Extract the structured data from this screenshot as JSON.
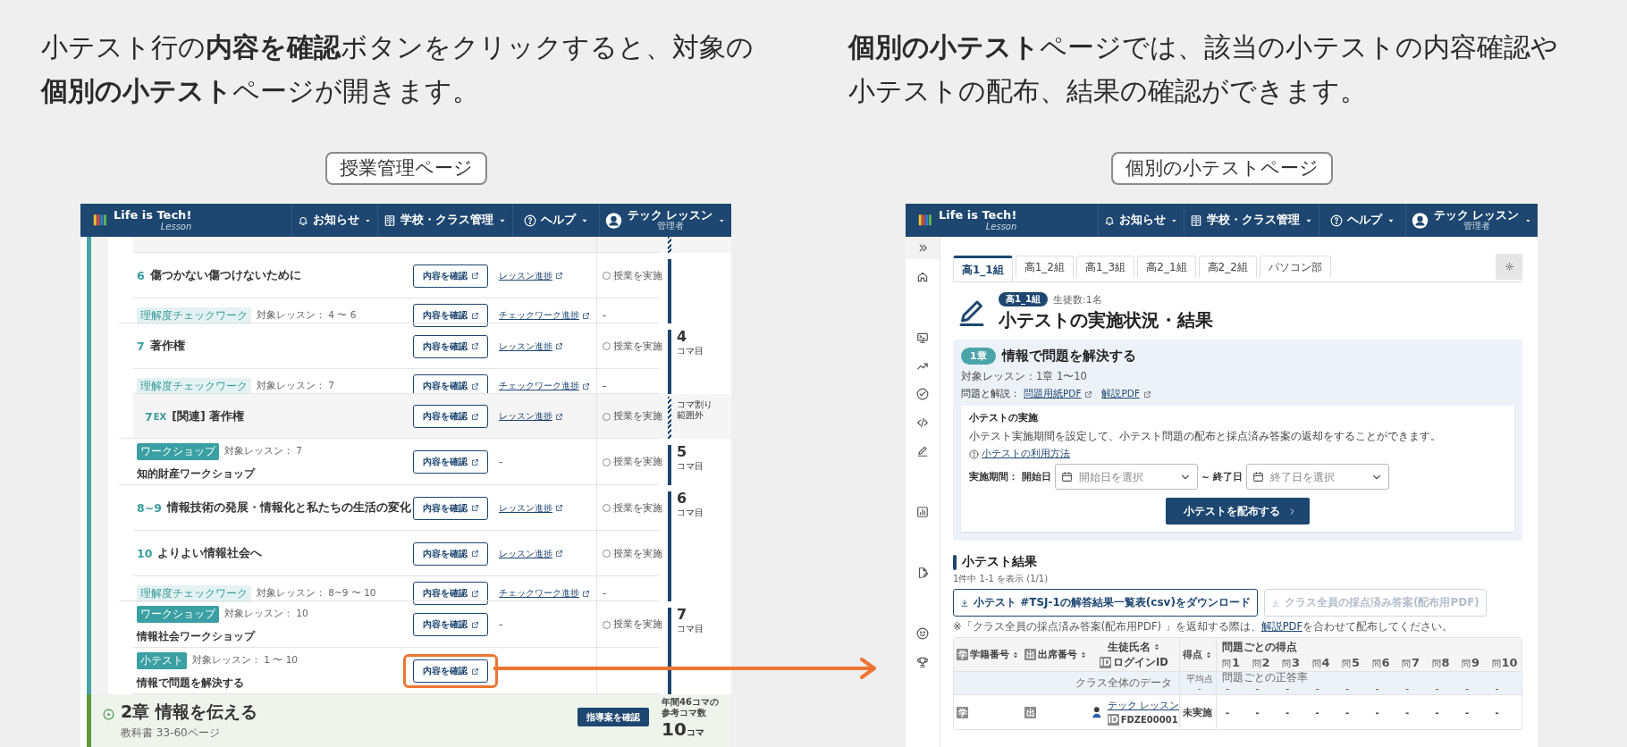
{
  "captions": [
    {
      "text": "小テスト行の**内容を確認**ボタンをクリックすると、対象の**個別の小テスト**ページが開きます。"
    },
    {
      "text": "**個別の小テスト**ページでは、該当の小テストの内容確認や小テストの配布、結果の確認ができます。"
    }
  ],
  "lesson_page": {
    "label": "授業管理ページ",
    "header": {
      "logo": "Life is Tech!",
      "logo_sub": "Lesson",
      "menus": [
        {
          "label": "お知らせ"
        },
        {
          "label": "学校・クラス管理"
        },
        {
          "label": "ヘルプ"
        }
      ],
      "user": {
        "name": "テック レッスン",
        "role": "管理者"
      }
    },
    "rows": [
      {
        "kind": "cut"
      },
      {
        "kind": "lesson",
        "number": "6",
        "title": "傷つかない傷つけないために",
        "button": "内容を確認",
        "highlighted": false,
        "link": "レッスン進捗",
        "status": "授業を実施",
        "checked": false
      },
      {
        "kind": "check",
        "tag": "理解度チェックワーク",
        "target": "対象レッスン： 4 〜 6",
        "button": "内容を確認",
        "highlighted": false,
        "link": "チェックワーク進捗",
        "status": "-"
      },
      {
        "kind": "lesson",
        "number": "7",
        "title": "著作権",
        "button": "内容を確認",
        "highlighted": false,
        "link": "レッスン進捗",
        "status": "授業を実施",
        "checked": false,
        "koma": "4",
        "koma_unit": "コマ目"
      },
      {
        "kind": "check",
        "tag": "理解度チェックワーク",
        "target": "対象レッスン： 7",
        "button": "内容を確認",
        "highlighted": false,
        "link": "チェックワーク進捗",
        "status": "-"
      },
      {
        "kind": "extra",
        "number": "7",
        "suffix": "EX",
        "title": "[関連] 著作権",
        "button": "内容を確認",
        "highlighted": false,
        "link": "レッスン進捗",
        "status": "授業を実施",
        "checked": false,
        "koma_note": "コマ割り範囲外"
      },
      {
        "kind": "workshop",
        "tag": "ワークショップ",
        "target": "対象レッスン： 7",
        "title": "知的財産ワークショップ",
        "button": "内容を確認",
        "highlighted": false,
        "link": "-",
        "status": "授業を実施",
        "checked": false,
        "koma": "5",
        "koma_unit": "コマ目"
      },
      {
        "kind": "lesson",
        "number": "8~9",
        "title": "情報技術の発展・情報化と私たちの生活の変化",
        "button": "内容を確認",
        "highlighted": false,
        "link": "レッスン進捗",
        "status": "授業を実施",
        "checked": false,
        "koma": "6",
        "koma_unit": "コマ目"
      },
      {
        "kind": "lesson",
        "number": "10",
        "title": "よりよい情報社会へ",
        "button": "内容を確認",
        "highlighted": false,
        "link": "レッスン進捗",
        "status": "授業を実施",
        "checked": false
      },
      {
        "kind": "check",
        "tag": "理解度チェックワーク",
        "target": "対象レッスン： 8~9 〜 10",
        "button": "内容を確認",
        "highlighted": false,
        "link": "チェックワーク進捗",
        "status": "-"
      },
      {
        "kind": "workshop",
        "tag": "ワークショップ",
        "target": "対象レッスン： 10",
        "title": "情報社会ワークショップ",
        "button": "内容を確認",
        "highlighted": false,
        "link": "-",
        "status": "授業を実施",
        "checked": false,
        "koma": "7",
        "koma_unit": "コマ目"
      },
      {
        "kind": "quiz",
        "tag": "小テスト",
        "target": "対象レッスン： 1 〜 10",
        "title": "情報で問題を解決する",
        "button": "内容を確認",
        "highlighted": true
      }
    ],
    "chapter": {
      "title": "2章 情報を伝える",
      "pages": "教科書 33-60ページ",
      "button": "指導案を確認",
      "koma_label": "年間46コマの参考コマ数",
      "koma": "10",
      "koma_unit": "コマ"
    }
  },
  "quiz_page": {
    "label": "個別の小テストページ",
    "header": {
      "logo": "Life is Tech!",
      "logo_sub": "Lesson",
      "menus": [
        {
          "label": "お知らせ"
        },
        {
          "label": "学校・クラス管理"
        },
        {
          "label": "ヘルプ"
        }
      ],
      "user": {
        "name": "テック レッスン",
        "role": "管理者"
      }
    },
    "tabs": [
      {
        "label": "高1_1組",
        "selected": true
      },
      {
        "label": "高1_2組",
        "selected": false
      },
      {
        "label": "高1_3組",
        "selected": false
      },
      {
        "label": "高2_1組",
        "selected": false
      },
      {
        "label": "高2_2組",
        "selected": false
      },
      {
        "label": "パソコン部",
        "selected": false
      }
    ],
    "class_badge": "高1_1組",
    "students": "生徒数:1名",
    "title": "小テストの実施状況・結果",
    "card": {
      "chapter": "1章",
      "title": "情報で問題を解決する",
      "target": "対象レッスン：1章 1〜10",
      "materials_label": "問題と解説：",
      "materials": [
        "問題用紙PDF",
        "解説PDF"
      ],
      "section_title": "小テストの実施",
      "description": "小テスト実施期間を設定して、小テスト問題の配布と採点済み答案の返却をすることができます。",
      "help_link": "小テストの利用方法",
      "period_label": "実施期間：",
      "start_label": "開始日",
      "start_placeholder": "開始日を選択",
      "separator": "~",
      "end_label": "終了日",
      "end_placeholder": "終了日を選択",
      "submit": "小テストを配布する"
    },
    "results": {
      "heading": "小テスト結果",
      "count": "1件中 1-1 を表示 (1/1)",
      "downloads": [
        {
          "label": "小テスト #TSJ-1の解答結果一覧表(csv)をダウンロード",
          "disabled": false
        },
        {
          "label": "クラス全員の採点済み答案(配布用PDF)",
          "disabled": true
        }
      ],
      "note_before": "※「クラス全員の採点済み答案(配布用PDF) 」を返却する際は、",
      "note_link": "解説PDF",
      "note_after": "を合わせて配布してください。",
      "columns": [
        {
          "label": "学籍番号",
          "badge": "学"
        },
        {
          "label": "出席番号",
          "badge": "出"
        },
        {
          "label": "生徒氏名",
          "sub": "ログインID",
          "sub_badge": "ID"
        },
        {
          "label": "得点"
        }
      ],
      "problems_label": "問題ごとの得点",
      "problems": [
        {
          "prefix": "問",
          "number": "1"
        },
        {
          "prefix": "問",
          "number": "2"
        },
        {
          "prefix": "問",
          "number": "3"
        },
        {
          "prefix": "問",
          "number": "4"
        },
        {
          "prefix": "問",
          "number": "5"
        },
        {
          "prefix": "問",
          "number": "6"
        },
        {
          "prefix": "問",
          "number": "7"
        },
        {
          "prefix": "問",
          "number": "8"
        },
        {
          "prefix": "問",
          "number": "9"
        },
        {
          "prefix": "問",
          "number": "10"
        }
      ],
      "summary": {
        "label": "クラス全体のデータ",
        "avg_label": "平均点",
        "avg": "-",
        "rate_label": "問題ごとの正答率",
        "rates": [
          "-",
          "-",
          "-",
          "-",
          "-",
          "-",
          "-",
          "-",
          "-",
          "-"
        ]
      },
      "students": [
        {
          "number_badge": "学",
          "attendance_badge": "出",
          "name": "テック レッスン",
          "login_badge": "ID",
          "login": "FDZE00001",
          "score": "未実施",
          "scores": [
            "-",
            "-",
            "-",
            "-",
            "-",
            "-",
            "-",
            "-",
            "-",
            "-"
          ]
        }
      ]
    }
  }
}
